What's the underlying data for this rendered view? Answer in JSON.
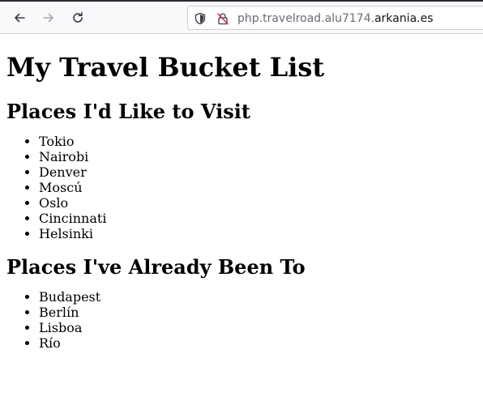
{
  "browser": {
    "url_host_prefix": "php.travelroad.alu7174.",
    "url_domain": "arkania.es",
    "icons": {
      "back": "arrow-left-icon",
      "forward": "arrow-right-icon",
      "reload": "reload-icon",
      "tracking": "shield-icon",
      "insecure": "insecure-lock-icon"
    }
  },
  "page": {
    "title": "My Travel Bucket List",
    "wishlist": {
      "heading": "Places I'd Like to Visit",
      "items": [
        "Tokio",
        "Nairobi",
        "Denver",
        "Moscú",
        "Oslo",
        "Cincinnati",
        "Helsinki"
      ]
    },
    "visited": {
      "heading": "Places I've Already Been To",
      "items": [
        "Budapest",
        "Berlín",
        "Lisboa",
        "Río"
      ]
    }
  },
  "colors": {
    "toolbar_bg": "#f9f9fb",
    "url_muted": "#6b6b75",
    "url_strong": "#15141a",
    "insecure_accent": "#e22850"
  }
}
